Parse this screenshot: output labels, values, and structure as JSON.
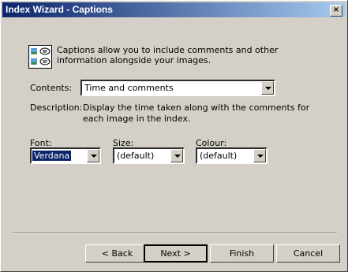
{
  "window": {
    "title": "Index Wizard - Captions",
    "close_glyph": "×"
  },
  "intro": {
    "text": "Captions allow you to include comments and other information alongside your images.",
    "icon": "captions-icon"
  },
  "contents": {
    "label": "Contents:",
    "value": "Time and comments"
  },
  "description": {
    "label": "Description:",
    "text": "Display the time taken along with the comments for each image in the index."
  },
  "font": {
    "label": "Font:",
    "value": "Verdana"
  },
  "size": {
    "label": "Size:",
    "value": "(default)"
  },
  "colour": {
    "label": "Colour:",
    "value": "(default)"
  },
  "buttons": {
    "back": "< Back",
    "next": "Next >",
    "finish": "Finish",
    "cancel": "Cancel"
  }
}
